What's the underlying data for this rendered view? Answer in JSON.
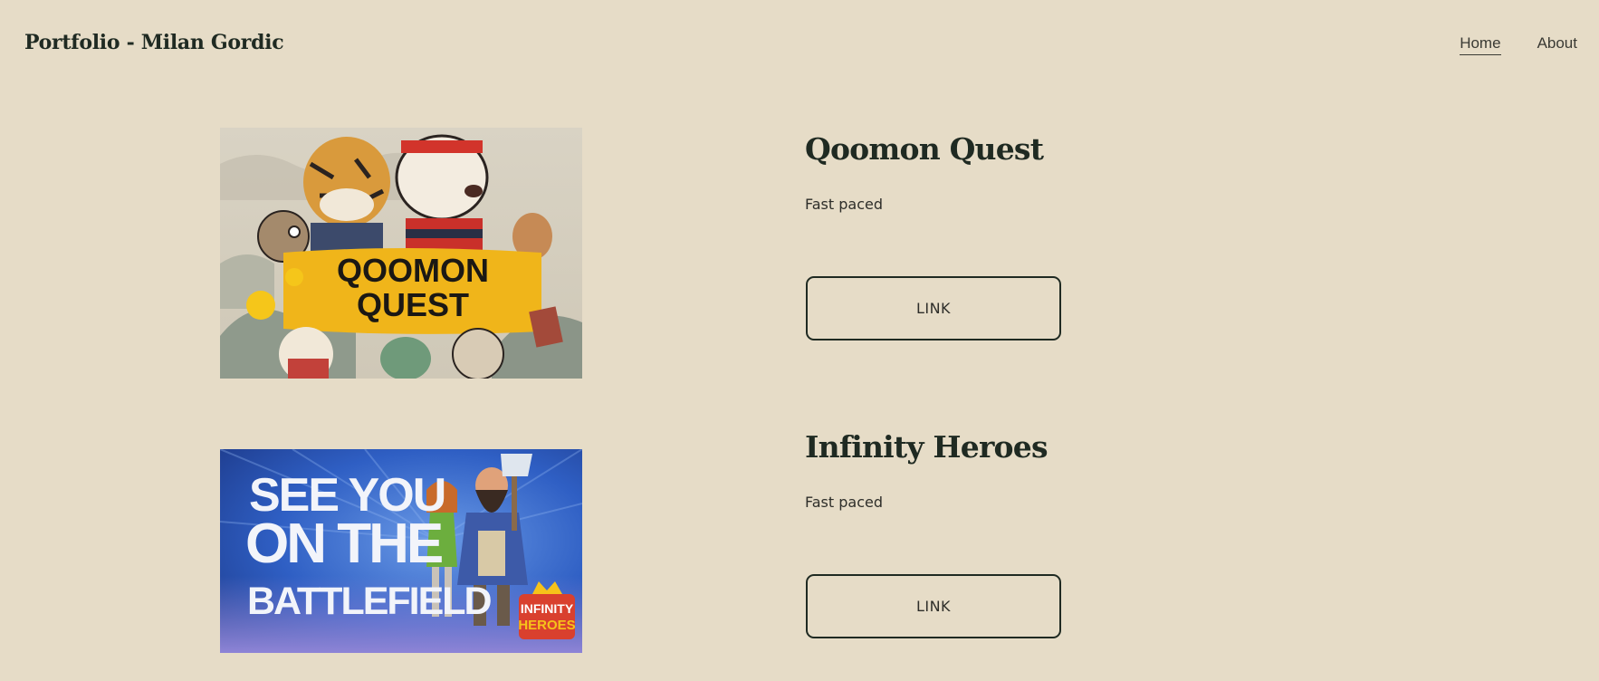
{
  "header": {
    "site_title": "Portfolio - Milan Gordic",
    "nav": [
      {
        "label": "Home",
        "active": true
      },
      {
        "label": "About",
        "active": false
      }
    ]
  },
  "projects": [
    {
      "title": "Qoomon Quest",
      "description": "Fast paced",
      "link_label": "LINK",
      "image": {
        "banner_line1": "QOOMON",
        "banner_line2": "QUEST",
        "banner_color": "#f0b51a"
      }
    },
    {
      "title": "Infinity Heroes",
      "description": "Fast paced",
      "link_label": "LINK",
      "image": {
        "headline_line1": "SEE YOU",
        "headline_line2": "ON THE",
        "headline_line3": "BATTLEFIELD",
        "logo_line1": "INFINITY",
        "logo_line2": "HEROES",
        "bg_color": "#2f5fc4"
      }
    }
  ]
}
